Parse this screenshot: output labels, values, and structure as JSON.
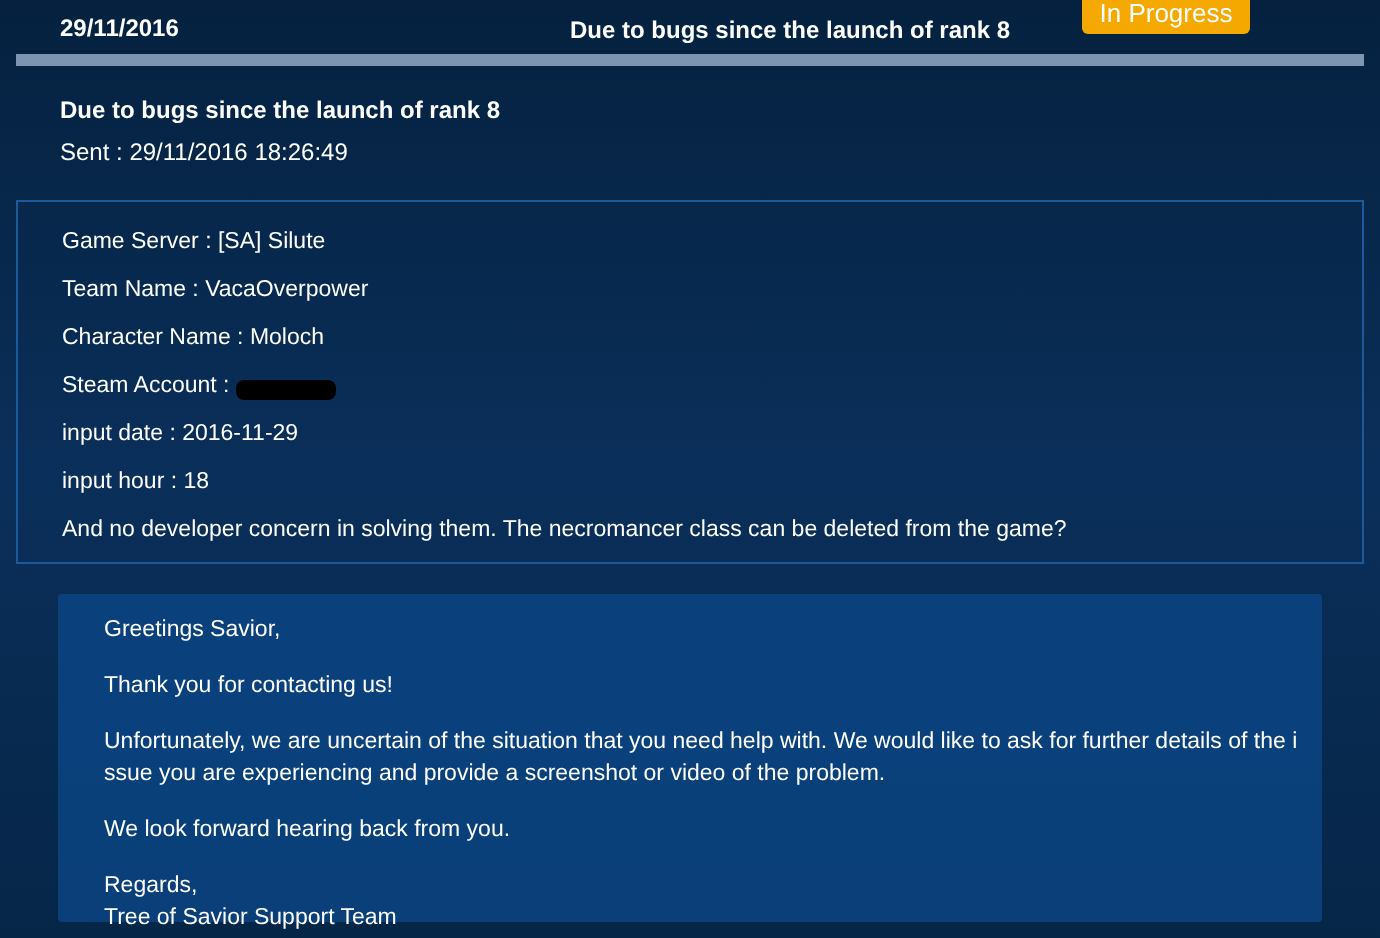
{
  "header": {
    "date": "29/11/2016",
    "title": "Due to bugs since the launch of rank 8",
    "status": {
      "label": "In Progress",
      "kind": "in_progress"
    }
  },
  "message": {
    "subject": "Due to bugs since the launch of rank 8",
    "sent": "Sent : 29/11/2016 18:26:49"
  },
  "details": [
    {
      "text": "Game Server : [SA] Silute",
      "redacted": false
    },
    {
      "text": "Team Name : VacaOverpower",
      "redacted": false
    },
    {
      "text": "Character Name : Moloch",
      "redacted": false
    },
    {
      "text": "Steam Account :",
      "redacted": true
    },
    {
      "text": "input date : 2016-11-29",
      "redacted": false
    },
    {
      "text": "input hour : 18",
      "redacted": false
    },
    {
      "text": "And no developer concern in solving them. The necromancer class can be deleted from the game?",
      "redacted": false
    }
  ],
  "reply": {
    "paragraphs": [
      "Greetings Savior,",
      "Thank you for contacting us!",
      "Unfortunately, we are uncertain of the situation that you need help with. We would like to ask for further details of the issue you are experiencing and provide a screenshot or video of the problem.",
      "We look forward hearing back from you."
    ],
    "signature": [
      "Regards,",
      "Tree of Savior Support Team"
    ]
  }
}
